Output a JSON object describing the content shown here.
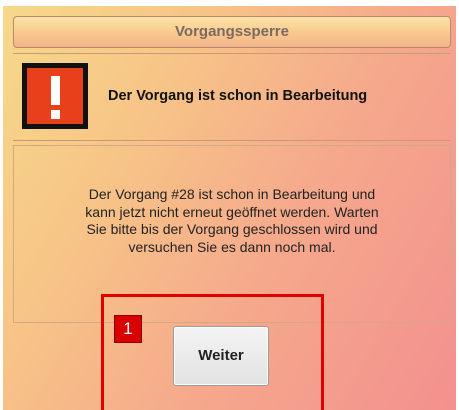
{
  "dialog": {
    "title": "Vorgangssperre",
    "header": "Der Vorgang ist schon in Bearbeitung",
    "warning_icon": "exclamation-warning-icon",
    "message_lines": [
      "Der Vorgang #28 ist schon in Bearbeitung und",
      "kann jetzt nicht erneut geöffnet werden. Warten",
      "Sie bitte bis der  Vorgang geschlossen wird und",
      "versuchen Sie es dann noch mal."
    ],
    "button_label": "Weiter"
  },
  "annotation": {
    "marker_label": "1",
    "color": "#e00000"
  },
  "colors": {
    "warning_red": "#e8401b",
    "title_text": "#7c6a62"
  }
}
